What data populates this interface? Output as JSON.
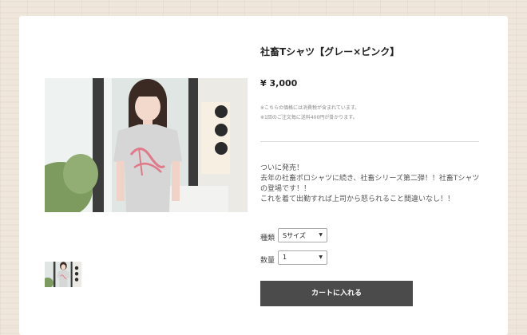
{
  "product": {
    "title": "社畜Tシャツ【グレー×ピンク】",
    "price": "¥ 3,000",
    "notes": [
      "※こちらの価格には消費税が含まれています。",
      "※1回のご注文毎に送料400円が掛かります。"
    ],
    "description": [
      "ついに発売！",
      "去年の社畜ポロシャツに続き、社畜シリーズ第二弾！！社畜Tシャツの登場です！！",
      "これを着て出勤すれば上司から怒られること間違いなし！！"
    ]
  },
  "options": {
    "kind": {
      "label": "種類",
      "selected": "Sサイズ"
    },
    "quantity": {
      "label": "数量",
      "selected": "1"
    }
  },
  "cart": {
    "button_label": "カートに入れる"
  },
  "colors": {
    "button_bg": "#4b4b4b",
    "shirt": "#d9d9d9",
    "print_pink": "#e07a8a"
  }
}
